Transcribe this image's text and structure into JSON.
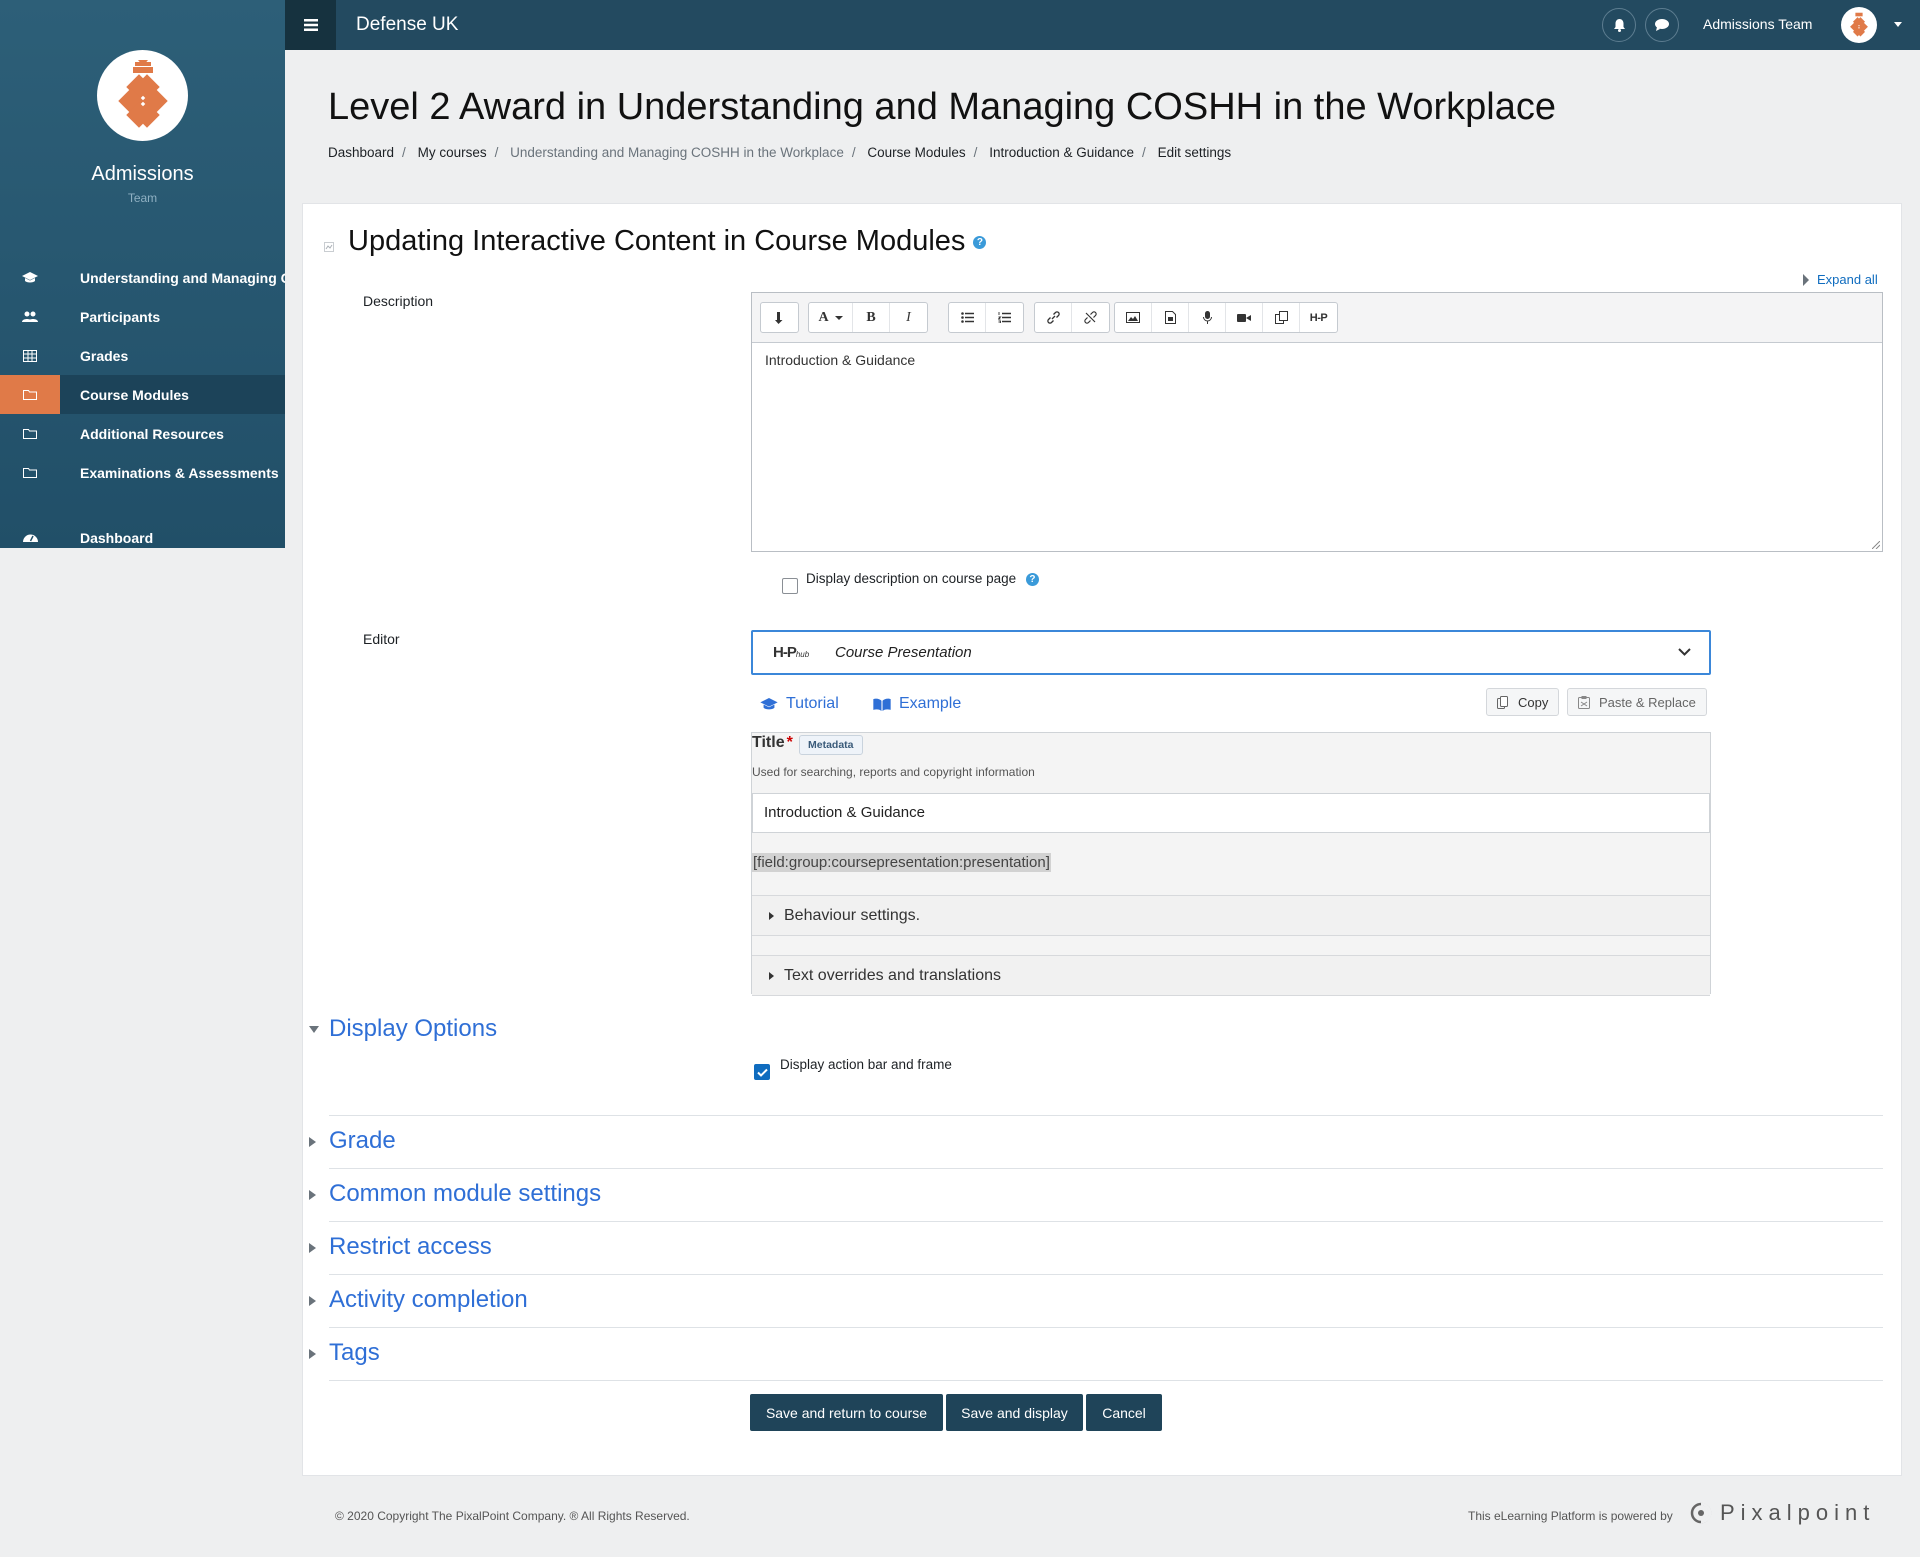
{
  "sidebar": {
    "brand_name": "Admissions",
    "brand_sub": "Team",
    "items": [
      {
        "label": "Understanding and Managing COSHH in the Workplace",
        "icon": "graduation-cap-icon"
      },
      {
        "label": "Participants",
        "icon": "users-icon"
      },
      {
        "label": "Grades",
        "icon": "table-icon"
      },
      {
        "label": "Course Modules",
        "icon": "folder-icon"
      },
      {
        "label": "Additional Resources",
        "icon": "folder-icon"
      },
      {
        "label": "Examinations & Assessments",
        "icon": "folder-icon"
      },
      {
        "label": "Dashboard",
        "icon": "dashboard-icon"
      }
    ],
    "active_color": "#e07a48"
  },
  "topbar": {
    "site_name": "Defense UK",
    "user_name": "Admissions Team"
  },
  "page": {
    "title": "Level 2 Award in Understanding and Managing COSHH in the Workplace",
    "breadcrumb": [
      "Dashboard",
      "My courses",
      "Understanding and Managing COSHH in the Workplace",
      "Course Modules",
      "Introduction & Guidance",
      "Edit settings"
    ]
  },
  "form": {
    "heading": "Updating Interactive Content in Course Modules",
    "help_glyph": "?",
    "expand_all": "Expand all",
    "description_label": "Description",
    "description_text": "Introduction & Guidance",
    "display_description_label": "Display description on course page",
    "editor_label": "Editor",
    "toolbar_text": {
      "font": "A",
      "bold": "B",
      "italic": "I",
      "h5p": "H-P"
    }
  },
  "h5p": {
    "hub_logo": "H-P",
    "hub_suffix": "hub",
    "content_type": "Course Presentation",
    "tutorial_label": "Tutorial",
    "example_label": "Example",
    "copy_label": "Copy",
    "paste_label": "Paste & Replace",
    "title_label": "Title",
    "required_mark": "*",
    "metadata_label": "Metadata",
    "title_desc": "Used for searching, reports and copyright information",
    "title_value": "Introduction & Guidance",
    "field_placeholder": "[field:group:coursepresentation:presentation]",
    "behaviour_label": "Behaviour settings.",
    "text_overrides_label": "Text overrides and translations"
  },
  "sections": {
    "display_options": "Display Options",
    "display_action_bar_label": "Display action bar and frame",
    "display_action_bar_checked": true,
    "grade": "Grade",
    "common": "Common module settings",
    "restrict": "Restrict access",
    "activity": "Activity completion",
    "tags": "Tags"
  },
  "buttons": {
    "save_return": "Save and return to course",
    "save_display": "Save and display",
    "cancel": "Cancel"
  },
  "footer": {
    "copyright": "© 2020 Copyright The PixalPoint Company. ® All Rights Reserved.",
    "powered": "This eLearning Platform is powered by",
    "brand": "Pixalpoint"
  }
}
